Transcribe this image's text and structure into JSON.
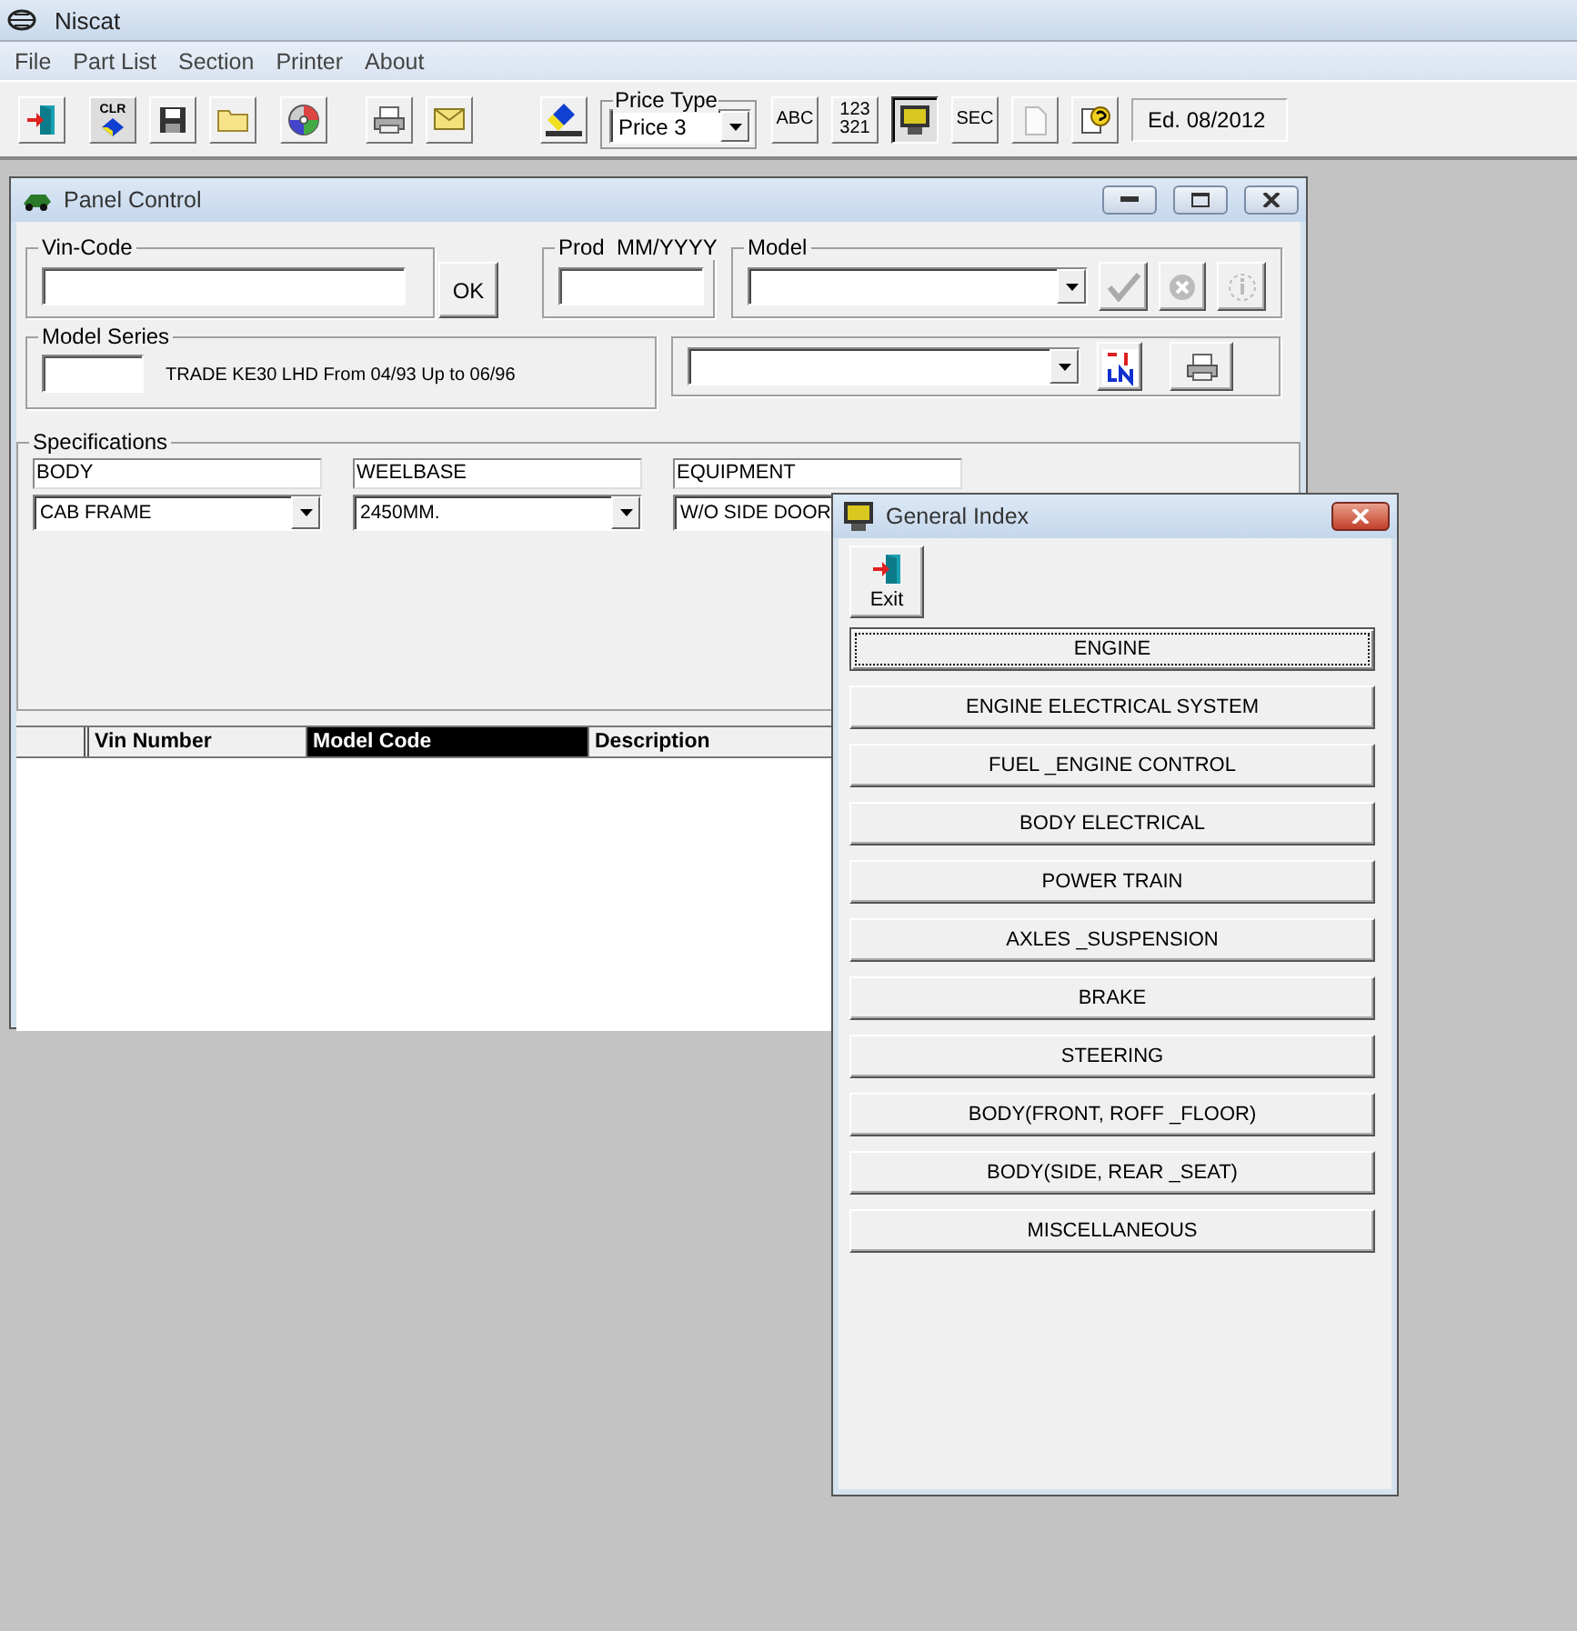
{
  "app": {
    "title": "Niscat"
  },
  "menu": [
    {
      "label": "File"
    },
    {
      "label": "Part List"
    },
    {
      "label": "Section"
    },
    {
      "label": "Printer"
    },
    {
      "label": "About"
    }
  ],
  "toolbar": [
    {
      "kind": "exit",
      "selected": false
    },
    {
      "kind": "clear",
      "label": "CLR",
      "selected": false
    },
    {
      "kind": "save",
      "selected": false
    },
    {
      "kind": "open",
      "selected": false
    },
    {
      "kind": "disc",
      "selected": false
    },
    {
      "kind": "print",
      "selected": false
    },
    {
      "kind": "mail",
      "selected": false
    },
    {
      "kind": "price-list",
      "selected": false
    },
    {
      "kind": "price-type",
      "label": "Price Type",
      "value": "Price 3"
    },
    {
      "kind": "text",
      "label": "ABC",
      "selected": false
    },
    {
      "kind": "text",
      "label": "123 321",
      "selected": false
    },
    {
      "kind": "monitor",
      "selected": true
    },
    {
      "kind": "text",
      "label": "SEC",
      "selected": false
    },
    {
      "kind": "new",
      "selected": false
    },
    {
      "kind": "help",
      "selected": false
    },
    {
      "kind": "edition",
      "label": "Ed. 08/2012"
    }
  ],
  "panel_control": {
    "title": "Panel Control",
    "vin_code": {
      "label": "Vin-Code"
    },
    "ok_button": "OK",
    "prod": {
      "label": "Prod  MM/YYYY"
    },
    "model": {
      "label": "Model"
    },
    "model_series": {
      "label": "Model Series",
      "description": "TRADE KE30 LHD From 04/93 Up to 06/96"
    },
    "specifications": {
      "label": "Specifications",
      "columns": [
        {
          "heading": "BODY",
          "value": "CAB FRAME"
        },
        {
          "heading": "WEELBASE",
          "value": "2450MM."
        },
        {
          "heading": "EQUIPMENT",
          "value": "W/O SIDE DOOR"
        }
      ]
    },
    "table": {
      "columns": [
        {
          "label": "Vin Number",
          "selected": false
        },
        {
          "label": "Model Code",
          "selected": true
        },
        {
          "label": "Description",
          "selected": false
        }
      ]
    }
  },
  "general_index": {
    "title": "General Index",
    "exit_button": "Exit",
    "sections": [
      {
        "label": "ENGINE",
        "selected": true
      },
      {
        "label": "ENGINE ELECTRICAL SYSTEM",
        "selected": false
      },
      {
        "label": "FUEL _ENGINE CONTROL",
        "selected": false
      },
      {
        "label": "BODY ELECTRICAL",
        "selected": false
      },
      {
        "label": "POWER TRAIN",
        "selected": false
      },
      {
        "label": "AXLES _SUSPENSION",
        "selected": false
      },
      {
        "label": "BRAKE",
        "selected": false
      },
      {
        "label": "STEERING",
        "selected": false
      },
      {
        "label": "BODY(FRONT, ROFF _FLOOR)",
        "selected": false
      },
      {
        "label": "BODY(SIDE, REAR _SEAT)",
        "selected": false
      },
      {
        "label": "MISCELLANEOUS",
        "selected": false
      }
    ]
  }
}
